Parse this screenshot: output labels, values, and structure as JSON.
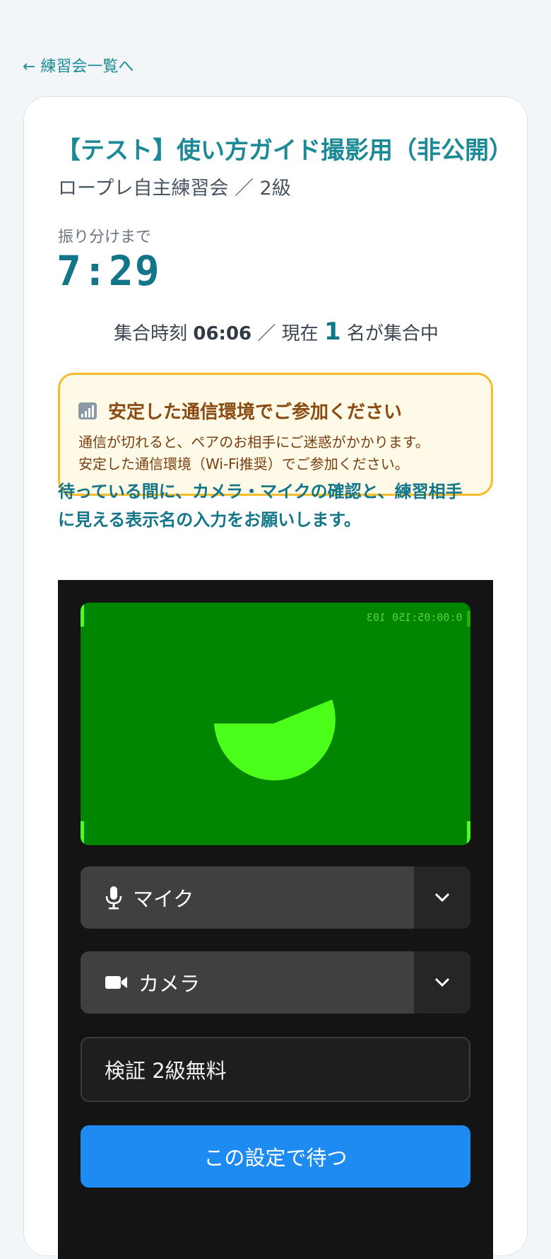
{
  "nav": {
    "back_link": "← 練習会一覧へ"
  },
  "event": {
    "title": "【テスト】使い方ガイド撮影用（非公開）",
    "subtitle": "ロープレ自主練習会 ／ 2級"
  },
  "countdown": {
    "label": "振り分けまで",
    "value": "7:29"
  },
  "gather": {
    "time_label": "集合時刻",
    "time": "06:06",
    "separator": "／ 現在",
    "count": "1",
    "count_suffix": "名が集合中"
  },
  "notice": {
    "icon": "signal-icon",
    "heading": "安定した通信環境でご参加ください",
    "line1": "通信が切れると、ペアのお相手にご迷惑がかかります。",
    "line2": "安定した通信環境（Wi-Fi推奨）でご参加ください。"
  },
  "instruction": {
    "line1": "待っている間に、カメラ・マイクの確認と、練習相手",
    "line2": "に見える表示名の入力をお願いします。"
  },
  "preview": {
    "timecode": "0:00:05:150 103",
    "background_color": "#008600",
    "pie_color": "#4cff1a"
  },
  "devices": {
    "mic_label": "マイク",
    "mic_icon": "microphone-icon",
    "camera_label": "カメラ",
    "camera_icon": "video-camera-icon"
  },
  "display_name": {
    "value": "検証 2級無料"
  },
  "actions": {
    "wait_button": "この設定で待つ"
  },
  "colors": {
    "accent": "#1c8a96",
    "notice_border": "#f5bd2a",
    "primary_button": "#1e8bf2"
  }
}
